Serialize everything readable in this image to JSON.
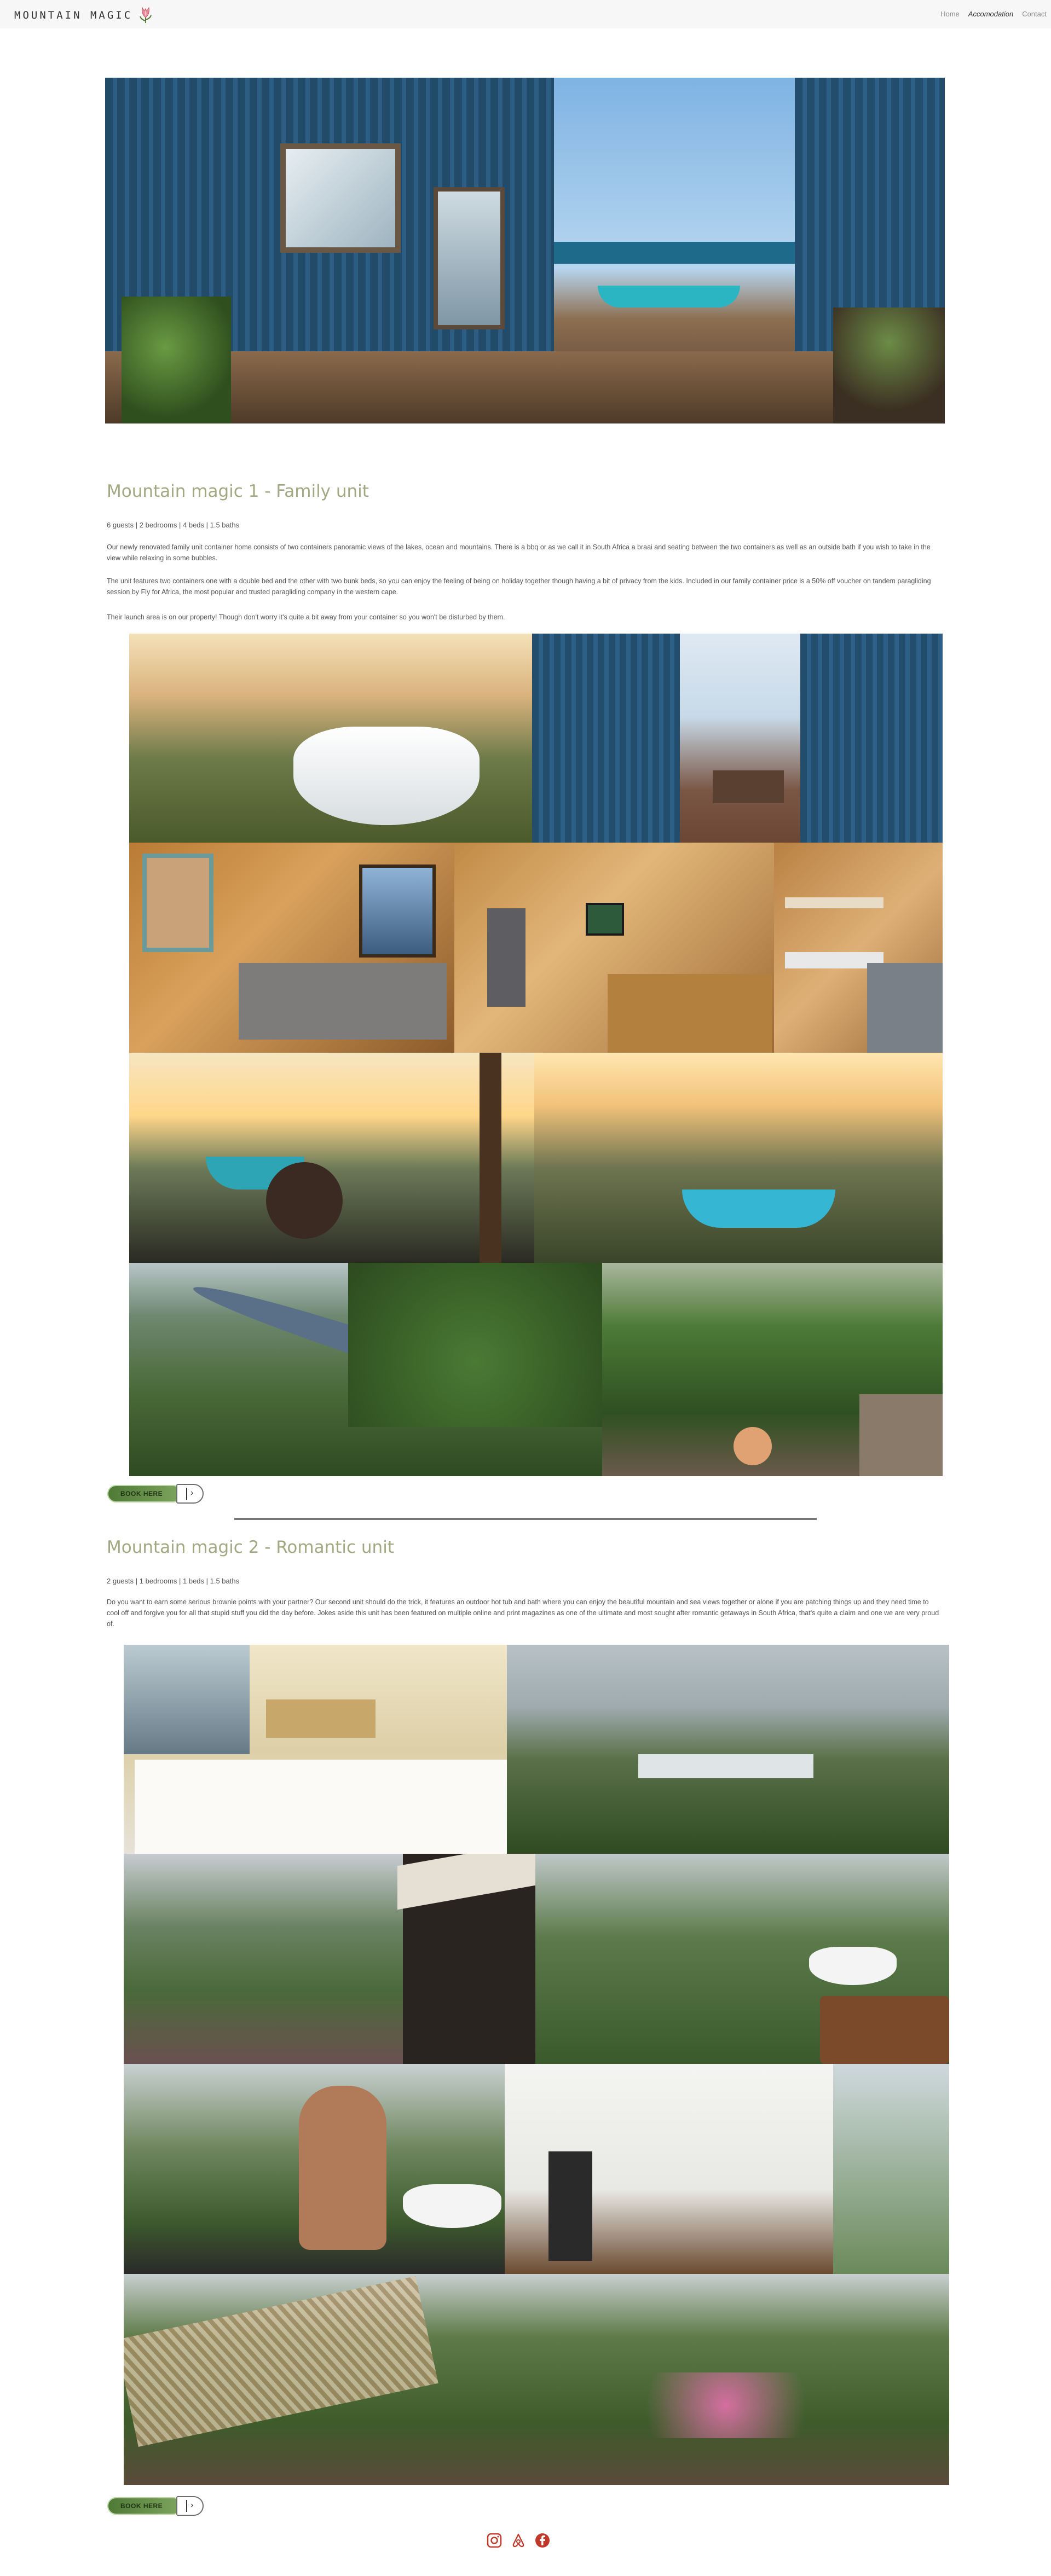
{
  "header": {
    "logo_text": "MOUNTAIN MAGIC",
    "nav": [
      {
        "label": "Home"
      },
      {
        "label": "Accomodation"
      },
      {
        "label": "Contact"
      }
    ]
  },
  "unit1": {
    "title": "Mountain magic 1 - Family unit",
    "meta": "6 guests | 2 bedrooms | 4 beds | 1.5 baths",
    "p1": "Our newly renovated family unit container home consists of two containers panoramic views of the lakes, ocean and mountains. There is a bbq or as we call it in South Africa a braai and seating between the two containers as well as an outside bath if you wish to take in the view while relaxing in some bubbles.",
    "p2": "The unit features two containers one with a double bed and the other with two bunk beds, so you can enjoy the feeling of being on holiday together though having a bit of privacy from the kids. Included in our family container price is a 50% off voucher on tandem paragliding session by Fly for Africa, the most popular and trusted paragliding company in the western cape.",
    "p3": "Their launch area is on our property! Though don't worry it's quite a bit away from your container so you won't be disturbed by them.",
    "book_label": "BOOK HERE"
  },
  "unit2": {
    "title": "Mountain magic 2 - Romantic unit",
    "meta": "2 guests | 1 bedrooms | 1 beds | 1.5 baths",
    "p1": "Do you want to earn some serious brownie points with your partner? Our second unit should do the trick, it features an outdoor hot tub and bath where you can enjoy the beautiful mountain and sea views together or alone if you are patching things up and they need time to cool off and forgive you for all that stupid stuff you did the day before. Jokes aside this unit has been featured on multiple online and print magazines as one of the ultimate and most sought after romantic getaways in South Africa, that's quite a claim and one we are very proud of.",
    "book_label": "BOOK HERE"
  },
  "footer": {
    "social": [
      "instagram-icon",
      "airbnb-icon",
      "facebook-icon"
    ],
    "accent": "#c0392b"
  },
  "colors": {
    "title": "#a3a882",
    "header_bg": "#f7f7f7",
    "container_blue": "#2d5a7b"
  }
}
